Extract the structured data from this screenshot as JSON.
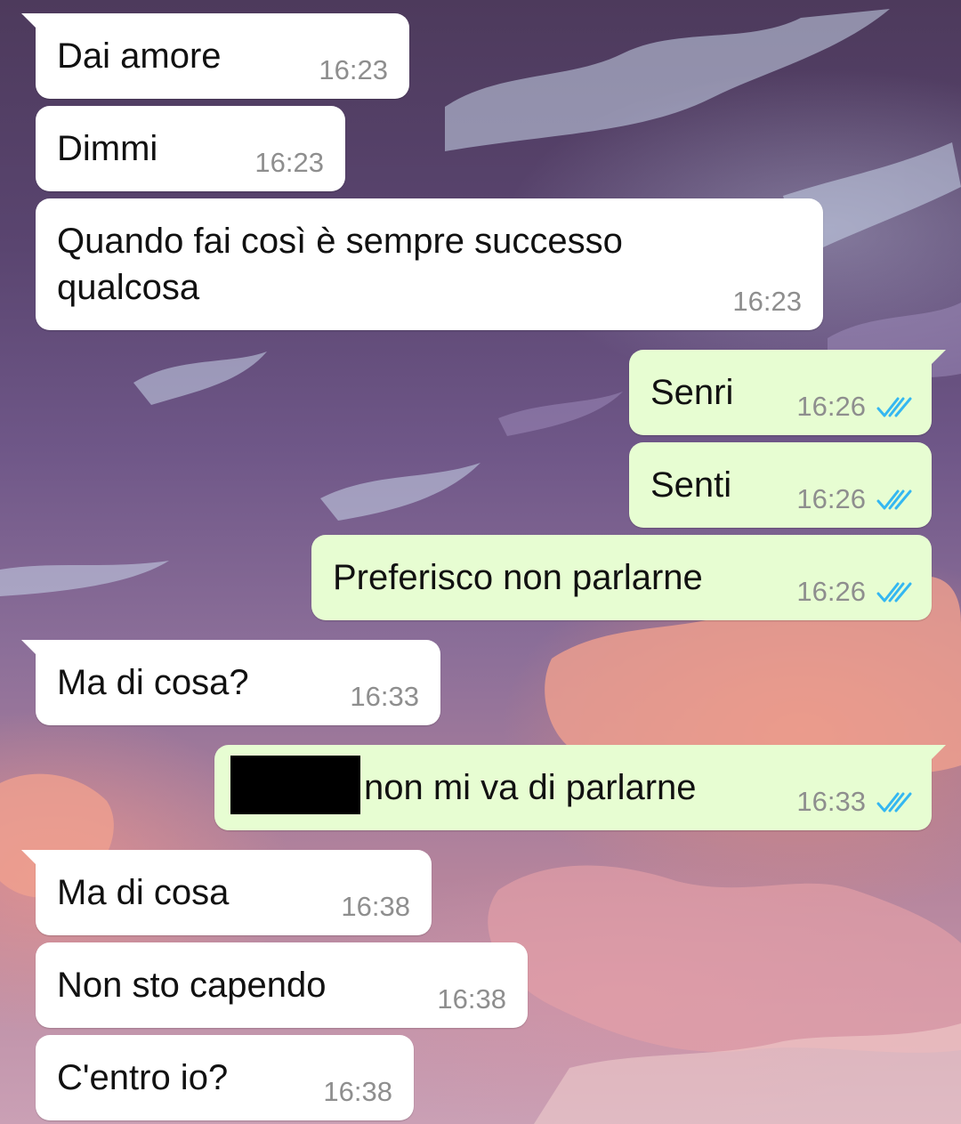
{
  "theme": {
    "incoming_bubble": "#ffffff",
    "outgoing_bubble": "#e7fdd2",
    "tick_color": "#34b7f1",
    "time_color": "#8e8e8e"
  },
  "messages": [
    {
      "dir": "in",
      "text": "Dai amore",
      "time": "16:23"
    },
    {
      "dir": "in",
      "text": "Dimmi",
      "time": "16:23"
    },
    {
      "dir": "in",
      "text": "Quando fai così è sempre successo\nqualcosa",
      "time": "16:23"
    },
    {
      "dir": "out",
      "text": "Senri",
      "time": "16:26",
      "status": "read"
    },
    {
      "dir": "out",
      "text": "Senti",
      "time": "16:26",
      "status": "read"
    },
    {
      "dir": "out",
      "text": "Preferisco non parlarne",
      "time": "16:26",
      "status": "read"
    },
    {
      "dir": "in",
      "text": "Ma di cosa?",
      "time": "16:33"
    },
    {
      "dir": "out",
      "text": "non mi va di parlarne",
      "time": "16:33",
      "status": "read",
      "redacted_prefix": true
    },
    {
      "dir": "in",
      "text": "Ma di cosa",
      "time": "16:38"
    },
    {
      "dir": "in",
      "text": "Non sto capendo",
      "time": "16:38"
    },
    {
      "dir": "in",
      "text": "C'entro io?",
      "time": "16:38"
    }
  ]
}
